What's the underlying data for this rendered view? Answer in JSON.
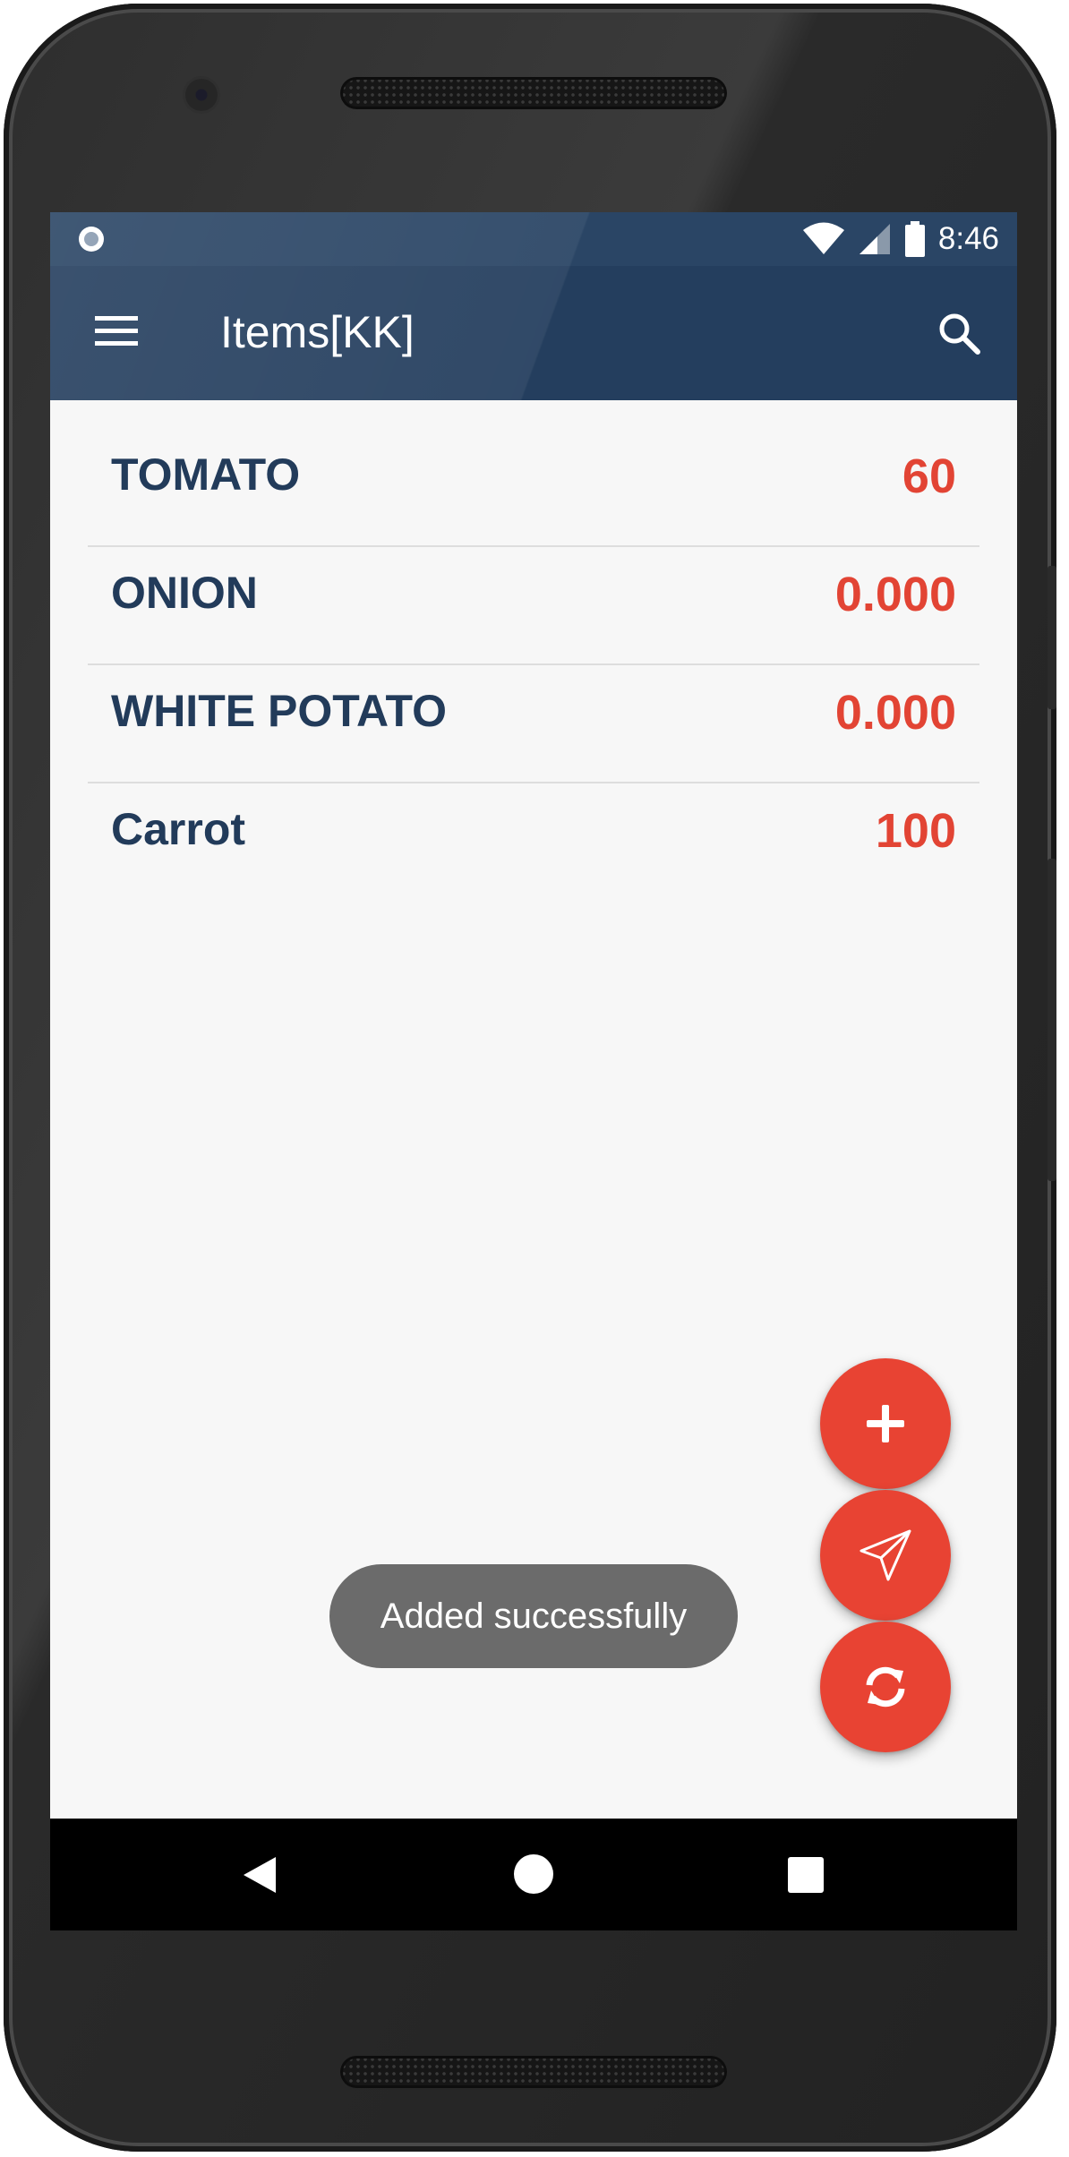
{
  "status_bar": {
    "time": "8:46",
    "icons": [
      "notification-dot-icon",
      "wifi-icon",
      "cell-signal-icon",
      "battery-icon"
    ]
  },
  "app_bar": {
    "title": "Items[KK]",
    "menu_icon": "hamburger-menu-icon",
    "search_icon": "search-icon"
  },
  "items": [
    {
      "name": "TOMATO",
      "qty": "60"
    },
    {
      "name": "ONION",
      "qty": "0.000"
    },
    {
      "name": "WHITE POTATO",
      "qty": "0.000"
    },
    {
      "name": "Carrot",
      "qty": "100"
    }
  ],
  "fabs": {
    "add_icon": "plus-icon",
    "send_icon": "send-icon",
    "sync_icon": "sync-icon"
  },
  "toast": {
    "message": "Added successfully"
  },
  "nav_bar": {
    "icons": [
      "back-icon",
      "home-icon",
      "recents-icon"
    ]
  },
  "colors": {
    "app_bar": "#243e5e",
    "item_name": "#223b5a",
    "item_qty": "#e24434",
    "fab": "#e84333",
    "toast": "#6b6b6b"
  }
}
